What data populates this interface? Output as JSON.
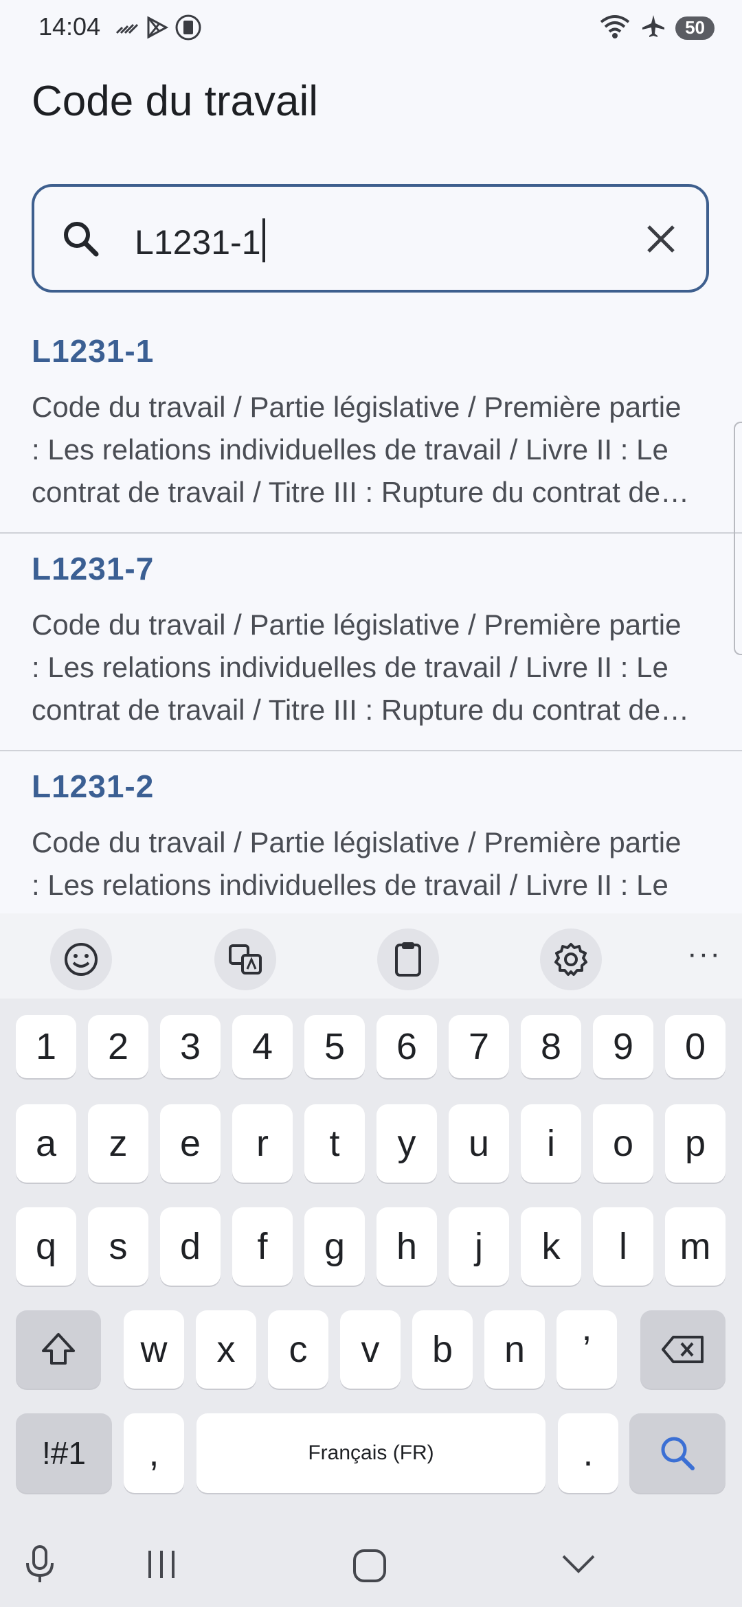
{
  "status_bar": {
    "time": "14:04",
    "battery": "50",
    "left_icons": [
      "no-signal-icon",
      "play-store-icon",
      "clipboard-icon"
    ],
    "right_icons": [
      "wifi-icon",
      "airplane-icon"
    ]
  },
  "page": {
    "title": "Code du travail"
  },
  "search": {
    "value": "L1231-1",
    "icon": "search-icon",
    "clear_icon": "close-icon"
  },
  "results": [
    {
      "title": "L1231-1",
      "path": "Code du travail / Partie législative / Première partie : Les relations individuelles de travail / Livre II : Le contrat de travail / Titre III : Rupture du contrat de travail à durée indéterminée"
    },
    {
      "title": "L1231-7",
      "path": "Code du travail / Partie législative / Première partie : Les relations individuelles de travail / Livre II : Le contrat de travail / Titre III : Rupture du contrat de travail à durée indéterminée"
    },
    {
      "title": "L1231-2",
      "path": "Code du travail / Partie législative / Première partie : Les relations individuelles de travail / Livre II : Le contrat de travail / Titre III : Rupture du contrat de travail à durée indéterminée"
    }
  ],
  "keyboard": {
    "toolbar": [
      "emoji-icon",
      "translate-icon",
      "clipboard-icon",
      "settings-icon",
      "more-icon"
    ],
    "more_label": "···",
    "row_numbers": [
      "1",
      "2",
      "3",
      "4",
      "5",
      "6",
      "7",
      "8",
      "9",
      "0"
    ],
    "row1": [
      "a",
      "z",
      "e",
      "r",
      "t",
      "y",
      "u",
      "i",
      "o",
      "p"
    ],
    "row2": [
      "q",
      "s",
      "d",
      "f",
      "g",
      "h",
      "j",
      "k",
      "l",
      "m"
    ],
    "row3": [
      "w",
      "x",
      "c",
      "v",
      "b",
      "n",
      "’"
    ],
    "symbols_label": "!#1",
    "comma_label": ",",
    "space_label": "Français (FR)",
    "period_label": ".",
    "accent_color": "#3b6fd4"
  },
  "nav_bar": [
    "microphone-icon",
    "recent-apps-icon",
    "home-icon",
    "hide-keyboard-icon"
  ]
}
